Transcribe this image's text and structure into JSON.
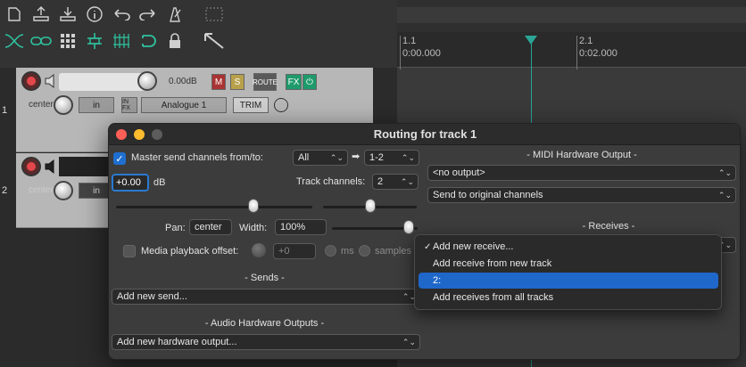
{
  "toolbar": {
    "icons": [
      "new-file-icon",
      "open-file-icon",
      "save-icon",
      "info-icon",
      "undo-icon",
      "redo-icon",
      "metronome-icon",
      "grid-icon",
      "auto-crossfade-icon",
      "link-icon",
      "snap-grid-icon",
      "ripple-icon",
      "lanes-icon",
      "loop-icon",
      "lock-icon",
      "trim-tool-icon"
    ]
  },
  "ruler": {
    "mark1_top": "1.1",
    "mark1_bottom": "0:00.000",
    "mark2_top": "2.1",
    "mark2_bottom": "0:02.000"
  },
  "tracks": [
    {
      "number": "1",
      "volume": "0.00dB",
      "pan": "center",
      "input_mode": "in",
      "input_name": "Analogue 1",
      "buttons": {
        "mute": "M",
        "solo": "S",
        "route": "ROUTE",
        "fx": "FX",
        "trim": "TRIM"
      }
    },
    {
      "number": "2",
      "pan": "center",
      "input_mode": "in"
    }
  ],
  "dialog": {
    "title": "Routing for track 1",
    "master_send_label": "Master send channels from/to:",
    "master_from": "All",
    "master_to": "1-2",
    "arrow": "➡",
    "volume_value": "+0.00",
    "volume_unit": "dB",
    "track_channels_label": "Track channels:",
    "track_channels_value": "2",
    "pan_label": "Pan:",
    "pan_value": "center",
    "width_label": "Width:",
    "width_value": "100%",
    "media_offset_label": "Media playback offset:",
    "media_offset_value": "+0",
    "ms_label": "ms",
    "samples_label": "samples",
    "sends_header": "-  Sends  -",
    "sends_select": "Add new send...",
    "audio_hw_header": "-  Audio Hardware Outputs  -",
    "audio_hw_select": "Add new hardware output...",
    "midi_hw_header": "-  MIDI Hardware Output  -",
    "midi_output_select": "<no output>",
    "midi_channel_select": "Send to original channels",
    "receives_header": "-  Receives  -"
  },
  "receive_menu": {
    "items": [
      {
        "label": "Add new receive...",
        "checked": true,
        "selected": false
      },
      {
        "label": "Add receive from new track",
        "checked": false,
        "selected": false
      },
      {
        "label": "2:",
        "checked": false,
        "selected": true
      },
      {
        "label": "Add receives from all tracks",
        "checked": false,
        "selected": false
      }
    ]
  },
  "colors": {
    "accent_blue": "#1f67c9",
    "playhead": "#2aa596",
    "record_red": "#e3474c",
    "toolbar_green": "#2ec4a0"
  }
}
